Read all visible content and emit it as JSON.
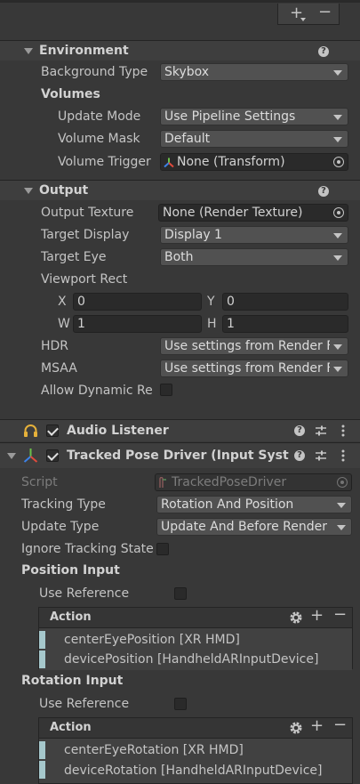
{
  "top_toolbar": {
    "add_symbol": "+",
    "remove_symbol": "−"
  },
  "environment": {
    "title": "Environment",
    "background_type": {
      "label": "Background Type",
      "value": "Skybox"
    },
    "volumes_header": "Volumes",
    "update_mode": {
      "label": "Update Mode",
      "value": "Use Pipeline Settings"
    },
    "volume_mask": {
      "label": "Volume Mask",
      "value": "Default"
    },
    "volume_trigger": {
      "label": "Volume Trigger",
      "value": "None (Transform)"
    }
  },
  "output": {
    "title": "Output",
    "output_texture": {
      "label": "Output Texture",
      "value": "None (Render Texture)"
    },
    "target_display": {
      "label": "Target Display",
      "value": "Display 1"
    },
    "target_eye": {
      "label": "Target Eye",
      "value": "Both"
    },
    "viewport_rect": {
      "label": "Viewport Rect",
      "x_label": "X",
      "x_value": "0",
      "y_label": "Y",
      "y_value": "0",
      "w_label": "W",
      "w_value": "1",
      "h_label": "H",
      "h_value": "1"
    },
    "hdr": {
      "label": "HDR",
      "value": "Use settings from Render F"
    },
    "msaa": {
      "label": "MSAA",
      "value": "Use settings from Render F"
    },
    "allow_dynamic": {
      "label": "Allow Dynamic Re",
      "checked": false
    }
  },
  "audio_listener": {
    "title": "Audio Listener",
    "enabled": true
  },
  "tracked_pose_driver": {
    "title": "Tracked Pose Driver (Input Syste",
    "enabled": true,
    "script": {
      "label": "Script",
      "value": "TrackedPoseDriver"
    },
    "tracking_type": {
      "label": "Tracking Type",
      "value": "Rotation And Position"
    },
    "update_type": {
      "label": "Update Type",
      "value": "Update And Before Render"
    },
    "ignore_tracking": {
      "label": "Ignore Tracking State",
      "checked": false
    },
    "position_input": {
      "title": "Position Input",
      "use_reference": {
        "label": "Use Reference",
        "checked": false
      },
      "action_header": "Action",
      "bindings": [
        "centerEyePosition [XR HMD]",
        "devicePosition [HandheldARInputDevice]"
      ]
    },
    "rotation_input": {
      "title": "Rotation Input",
      "use_reference": {
        "label": "Use Reference",
        "checked": false
      },
      "action_header": "Action",
      "bindings": [
        "centerEyeRotation [XR HMD]",
        "deviceRotation [HandheldARInputDevice]"
      ]
    }
  }
}
